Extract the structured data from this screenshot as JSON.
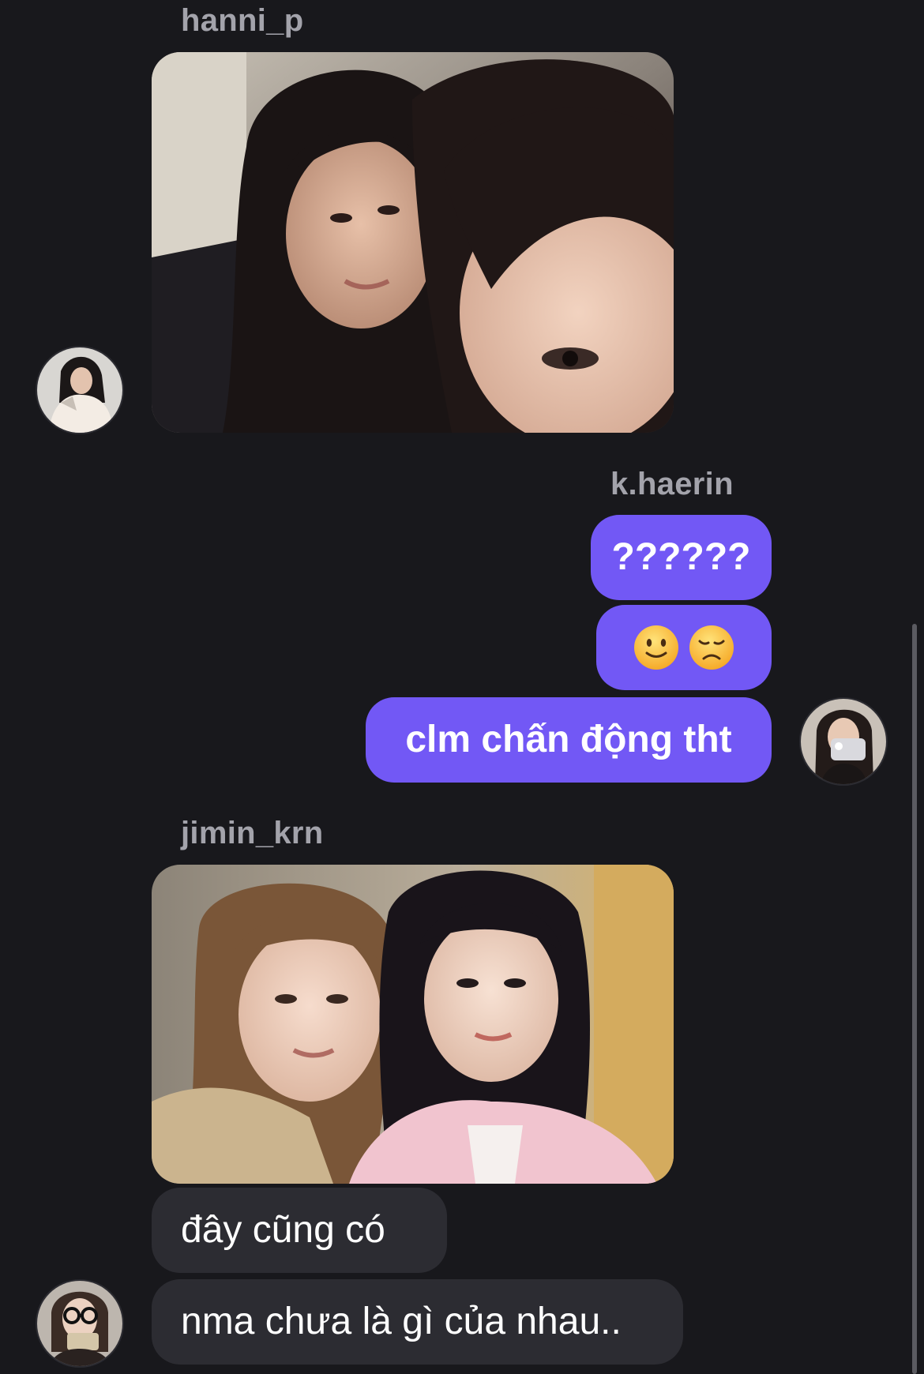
{
  "colors": {
    "background": "#18181c",
    "outgoing_bubble": "#7258f5",
    "incoming_bubble": "#2c2c32",
    "sender_name": "#a3a3ab"
  },
  "messages": {
    "hanni": {
      "sender": "hanni_p",
      "photo": "selfie-photo-two-people",
      "avatar": "hanni-avatar"
    },
    "haerin": {
      "sender": "k.haerin",
      "texts": [
        "??????",
        "clm chấn động tht"
      ],
      "emojis": [
        "slightly-smiling-face-emoji",
        "disappointed-face-emoji"
      ],
      "avatar": "haerin-avatar"
    },
    "jimin": {
      "sender": "jimin_krn",
      "photo": "selfie-photo-two-people",
      "texts": [
        "đây cũng có",
        "nma chưa là gì của nhau.."
      ],
      "avatar": "jimin-avatar"
    }
  }
}
